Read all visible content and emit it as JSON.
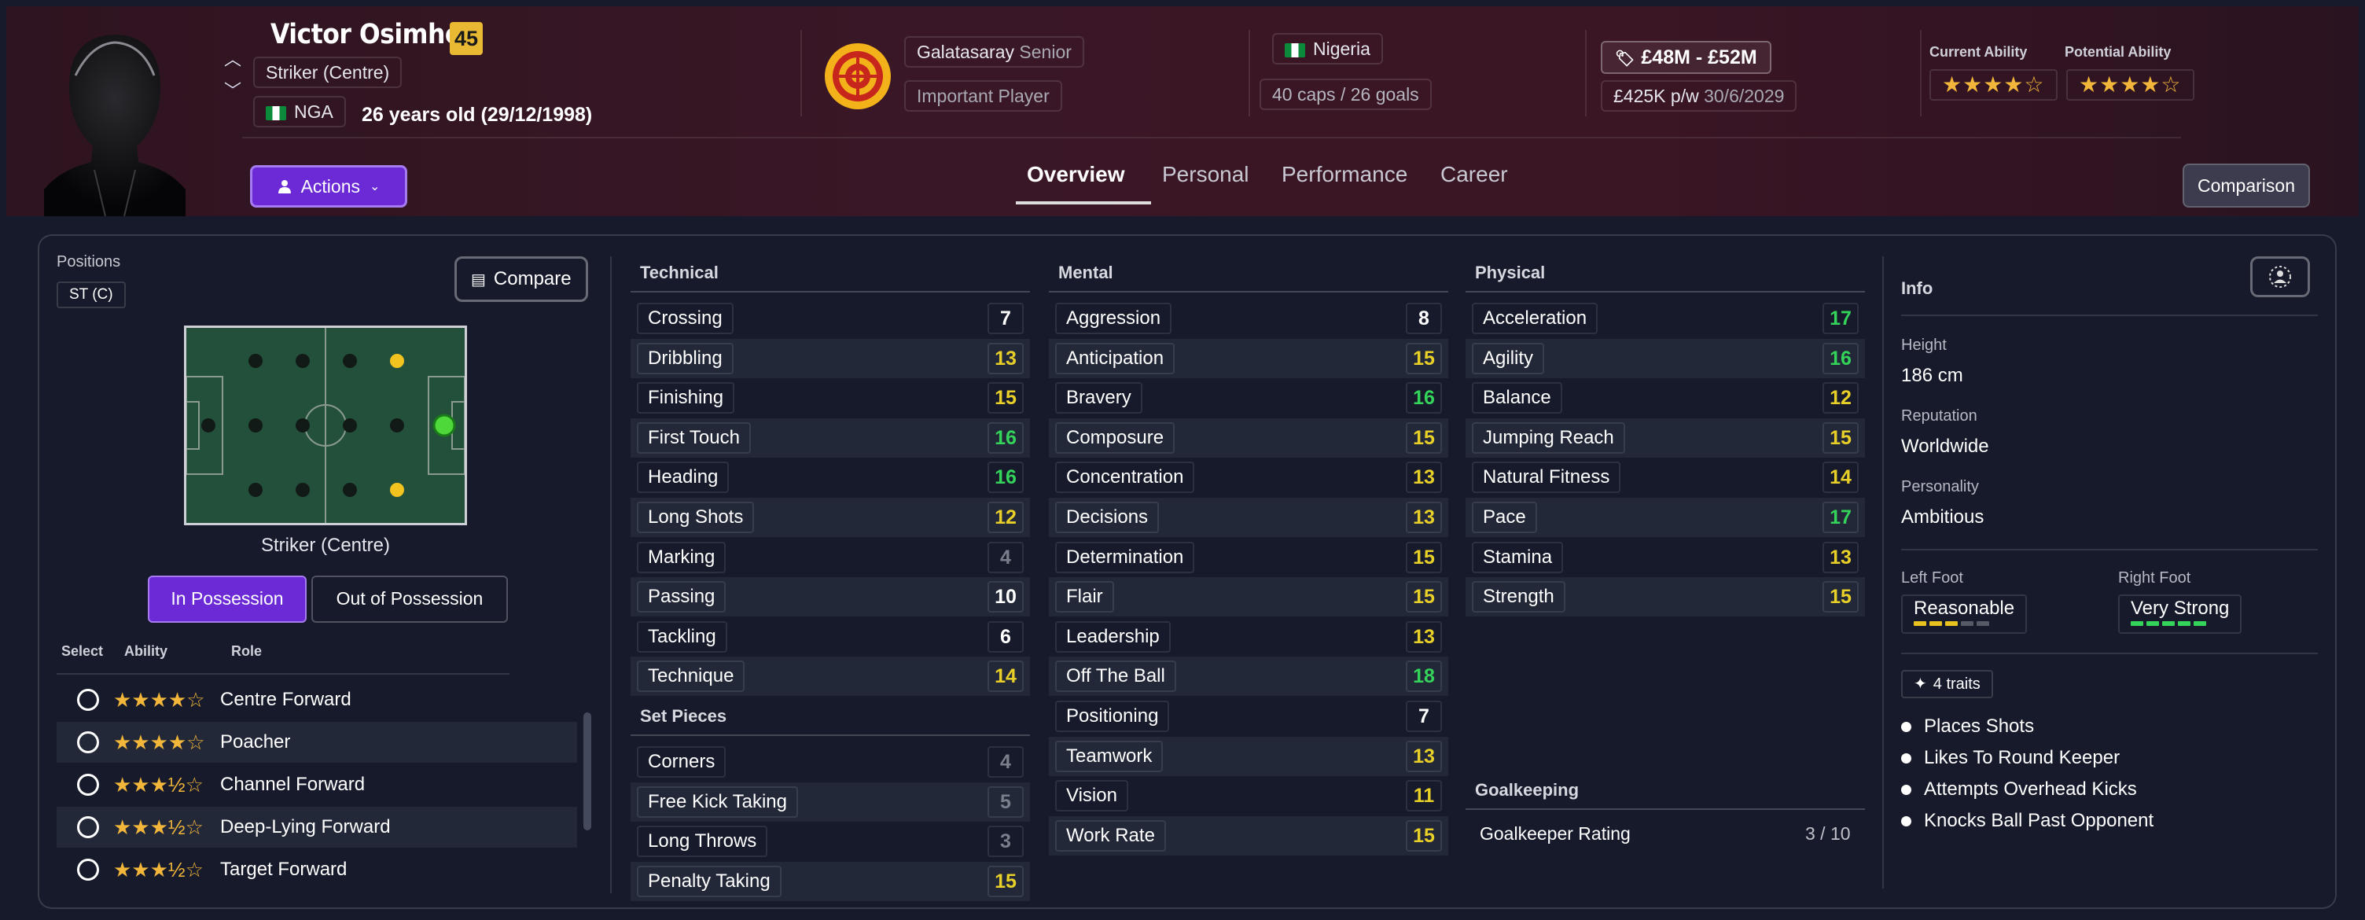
{
  "header": {
    "name": "Victor Osimhen",
    "age_badge": "45",
    "position": "Striker (Centre)",
    "nationality_code": "NGA",
    "age_text": "26 years old (29/12/1998)",
    "club": "Galatasaray",
    "club_level": "Senior",
    "squad_status": "Important Player",
    "country": "Nigeria",
    "caps_goals": "40 caps / 26 goals",
    "value": "£48M - £52M",
    "wage": "£425K p/w",
    "contract_end": "30/6/2029",
    "current_ability_label": "Current Ability",
    "potential_ability_label": "Potential Ability",
    "current_ability_stars": "★★★★☆",
    "potential_ability_stars": "★★★★☆",
    "actions_label": "Actions",
    "comparison_label": "Comparison",
    "tabs": [
      {
        "label": "Overview",
        "active": true
      },
      {
        "label": "Personal",
        "active": false
      },
      {
        "label": "Performance",
        "active": false
      },
      {
        "label": "Career",
        "active": false
      }
    ]
  },
  "positions": {
    "label": "Positions",
    "chip": "ST (C)",
    "compare_label": "Compare",
    "pitch_label": "Striker (Centre)",
    "in_possession": "In Possession",
    "out_of_possession": "Out of Possession",
    "columns": {
      "select": "Select",
      "ability": "Ability",
      "role": "Role"
    },
    "roles": [
      {
        "stars": "★★★★☆",
        "name": "Centre Forward"
      },
      {
        "stars": "★★★★☆",
        "name": "Poacher"
      },
      {
        "stars": "★★★½☆",
        "name": "Channel Forward"
      },
      {
        "stars": "★★★½☆",
        "name": "Deep-Lying Forward"
      },
      {
        "stars": "★★★½☆",
        "name": "Target Forward"
      }
    ]
  },
  "technical": {
    "title": "Technical",
    "attributes": [
      {
        "name": "Crossing",
        "value": "7"
      },
      {
        "name": "Dribbling",
        "value": "13"
      },
      {
        "name": "Finishing",
        "value": "15"
      },
      {
        "name": "First Touch",
        "value": "16"
      },
      {
        "name": "Heading",
        "value": "16"
      },
      {
        "name": "Long Shots",
        "value": "12"
      },
      {
        "name": "Marking",
        "value": "4"
      },
      {
        "name": "Passing",
        "value": "10"
      },
      {
        "name": "Tackling",
        "value": "6"
      },
      {
        "name": "Technique",
        "value": "14"
      }
    ]
  },
  "set_pieces": {
    "title": "Set Pieces",
    "attributes": [
      {
        "name": "Corners",
        "value": "4"
      },
      {
        "name": "Free Kick Taking",
        "value": "5"
      },
      {
        "name": "Long Throws",
        "value": "3"
      },
      {
        "name": "Penalty Taking",
        "value": "15"
      }
    ]
  },
  "mental": {
    "title": "Mental",
    "attributes": [
      {
        "name": "Aggression",
        "value": "8"
      },
      {
        "name": "Anticipation",
        "value": "15"
      },
      {
        "name": "Bravery",
        "value": "16"
      },
      {
        "name": "Composure",
        "value": "15"
      },
      {
        "name": "Concentration",
        "value": "13"
      },
      {
        "name": "Decisions",
        "value": "13"
      },
      {
        "name": "Determination",
        "value": "15"
      },
      {
        "name": "Flair",
        "value": "15"
      },
      {
        "name": "Leadership",
        "value": "13"
      },
      {
        "name": "Off The Ball",
        "value": "18"
      },
      {
        "name": "Positioning",
        "value": "7"
      },
      {
        "name": "Teamwork",
        "value": "13"
      },
      {
        "name": "Vision",
        "value": "11"
      },
      {
        "name": "Work Rate",
        "value": "15"
      }
    ]
  },
  "physical": {
    "title": "Physical",
    "attributes": [
      {
        "name": "Acceleration",
        "value": "17"
      },
      {
        "name": "Agility",
        "value": "16"
      },
      {
        "name": "Balance",
        "value": "12"
      },
      {
        "name": "Jumping Reach",
        "value": "15"
      },
      {
        "name": "Natural Fitness",
        "value": "14"
      },
      {
        "name": "Pace",
        "value": "17"
      },
      {
        "name": "Stamina",
        "value": "13"
      },
      {
        "name": "Strength",
        "value": "15"
      }
    ]
  },
  "goalkeeping": {
    "title": "Goalkeeping",
    "rating_label": "Goalkeeper Rating",
    "rating_value": "3 / 10"
  },
  "info": {
    "title": "Info",
    "height_label": "Height",
    "height": "186 cm",
    "reputation_label": "Reputation",
    "reputation": "Worldwide",
    "personality_label": "Personality",
    "personality": "Ambitious",
    "left_foot_label": "Left Foot",
    "left_foot": "Reasonable",
    "left_foot_level": 3,
    "right_foot_label": "Right Foot",
    "right_foot": "Very Strong",
    "right_foot_level": 5,
    "traits_label": "4 traits",
    "traits": [
      "Places Shots",
      "Likes To Round Keeper",
      "Attempts Overhead Kicks",
      "Knocks Ball Past Opponent"
    ]
  },
  "colors": {
    "accent_purple": "#6b2ad6",
    "val_green": "#34d35a",
    "val_yellow": "#e8d028",
    "val_white": "#ffffff",
    "val_grey": "#7a7f8c",
    "star_gold": "#f2b63a"
  }
}
